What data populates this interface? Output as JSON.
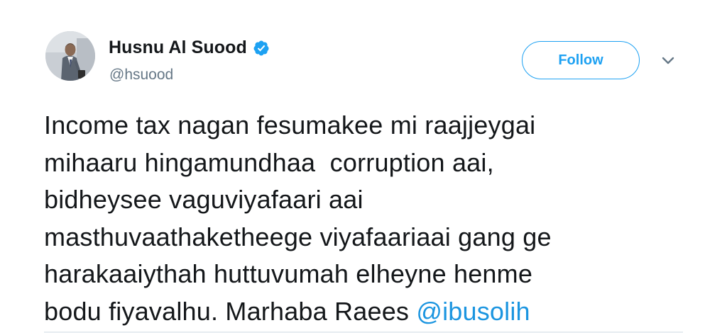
{
  "author": {
    "display_name": "Husnu Al Suood",
    "handle": "@hsuood",
    "verified": true,
    "avatar_icon": "profile-photo"
  },
  "actions": {
    "follow_label": "Follow",
    "menu_icon": "chevron-down-icon"
  },
  "tweet": {
    "lines": [
      "Income tax nagan fesumakee mi raajjeygai",
      "mihaaru hingamundhaa  corruption aai,",
      "bidheysee vaguviyafaari aai",
      "masthuvaathaketheege viyafaariaai gang ge",
      "harakaaiythah huttuvumah elheyne henme",
      "bodu fiyavalhu. Marhaba Raees "
    ],
    "mention": "@ibusolih"
  },
  "colors": {
    "accent": "#1da1f2",
    "mention": "#1b95e0",
    "text": "#14171a",
    "secondary_text": "#657786"
  }
}
